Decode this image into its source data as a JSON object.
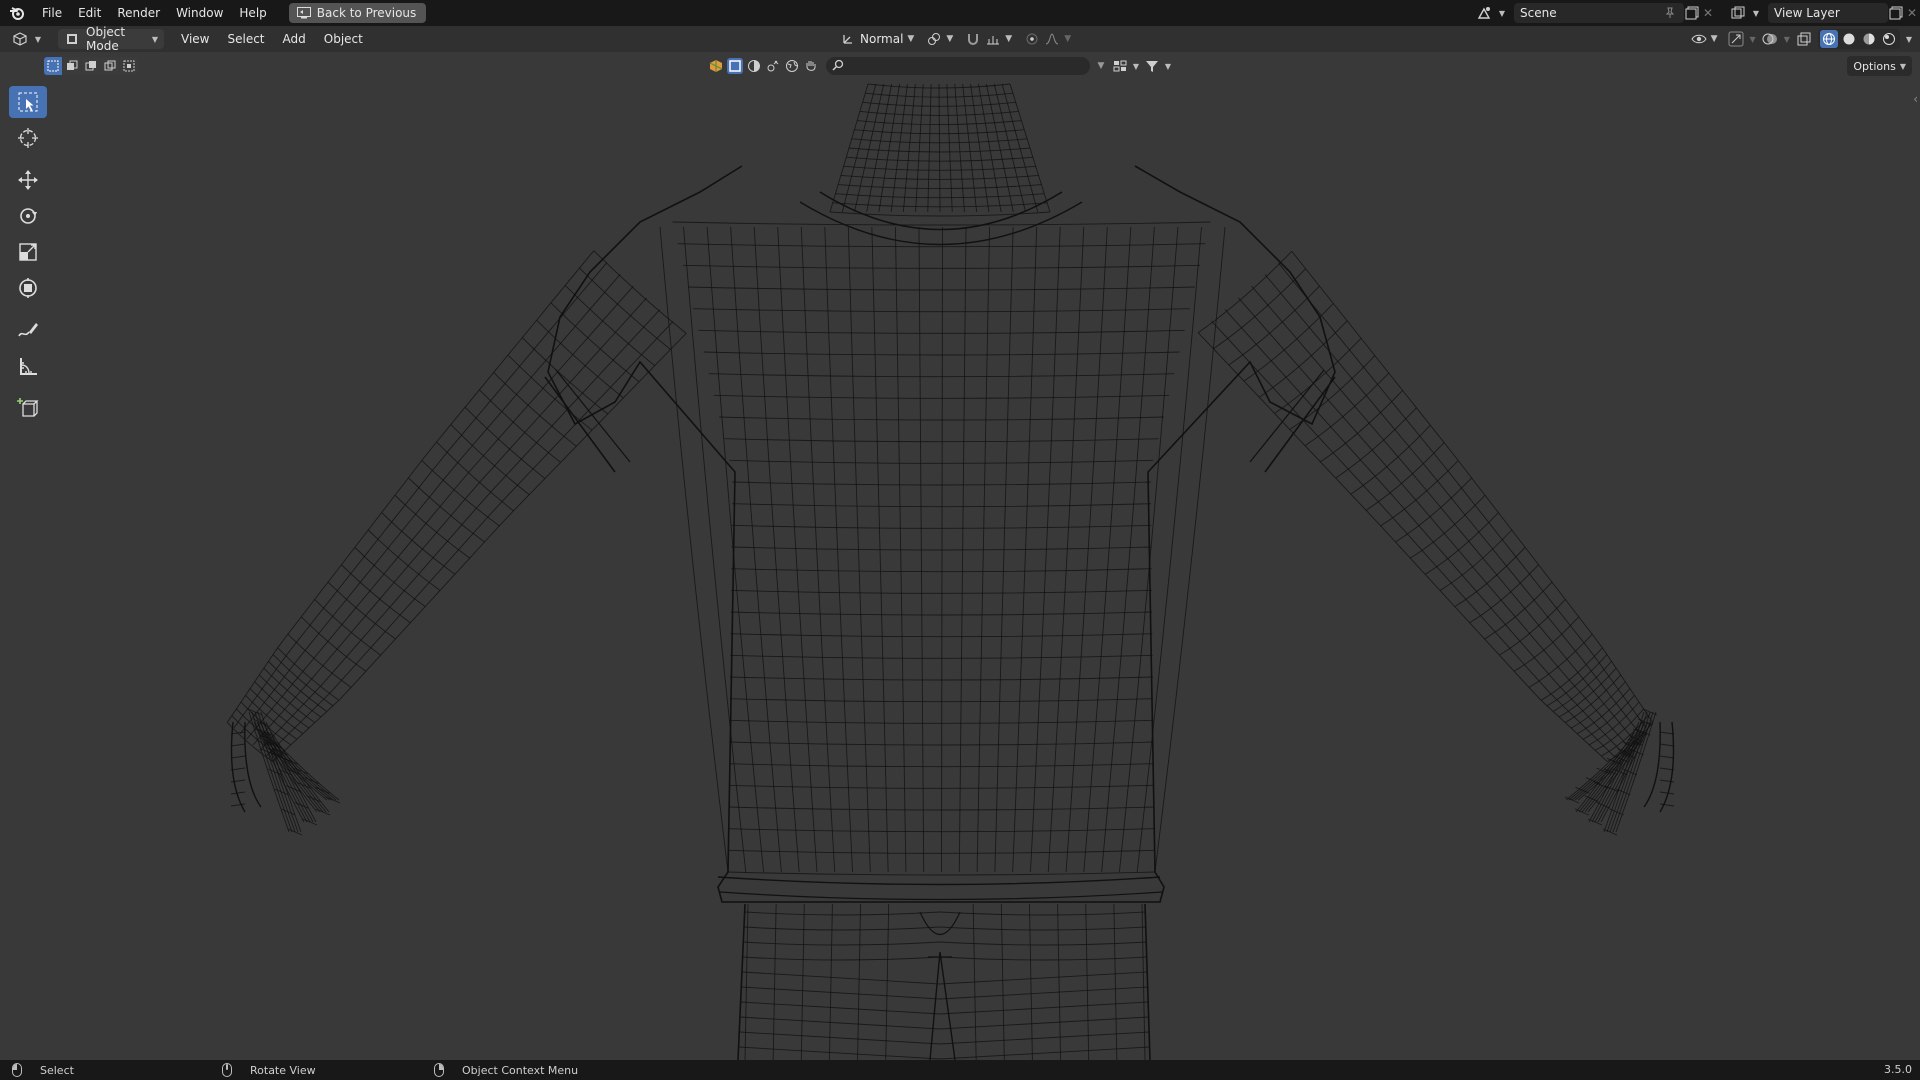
{
  "menubar": {
    "logo_icon": "blender-logo-icon",
    "items": [
      "File",
      "Edit",
      "Render",
      "Window",
      "Help"
    ],
    "back_button": "Back to Previous",
    "scene": "Scene",
    "view_layer": "View Layer"
  },
  "header": {
    "mode": "Object Mode",
    "menus": [
      "View",
      "Select",
      "Add",
      "Object"
    ],
    "orientation": "Normal",
    "options": "Options"
  },
  "viewport": {
    "search_placeholder": "",
    "accent_color": "#4772b3",
    "background_color": "#393939",
    "wire_color": "#111111"
  },
  "toolbar": {
    "tools": [
      {
        "name": "select-box-tool",
        "icon": "select-box-icon",
        "active": true
      },
      {
        "name": "cursor-tool",
        "icon": "cursor-icon",
        "active": false
      },
      {
        "name": "move-tool",
        "icon": "move-icon",
        "active": false
      },
      {
        "name": "rotate-tool",
        "icon": "rotate-icon",
        "active": false
      },
      {
        "name": "scale-tool",
        "icon": "scale-icon",
        "active": false
      },
      {
        "name": "transform-tool",
        "icon": "transform-icon",
        "active": false
      },
      {
        "name": "annotate-tool",
        "icon": "annotate-icon",
        "active": false
      },
      {
        "name": "measure-tool",
        "icon": "measure-icon",
        "active": false
      },
      {
        "name": "add-cube-tool",
        "icon": "add-cube-icon",
        "active": false
      }
    ]
  },
  "statusbar": {
    "left": "Select",
    "middle": "Rotate View",
    "right": "Object Context Menu",
    "version": "3.5.0"
  }
}
